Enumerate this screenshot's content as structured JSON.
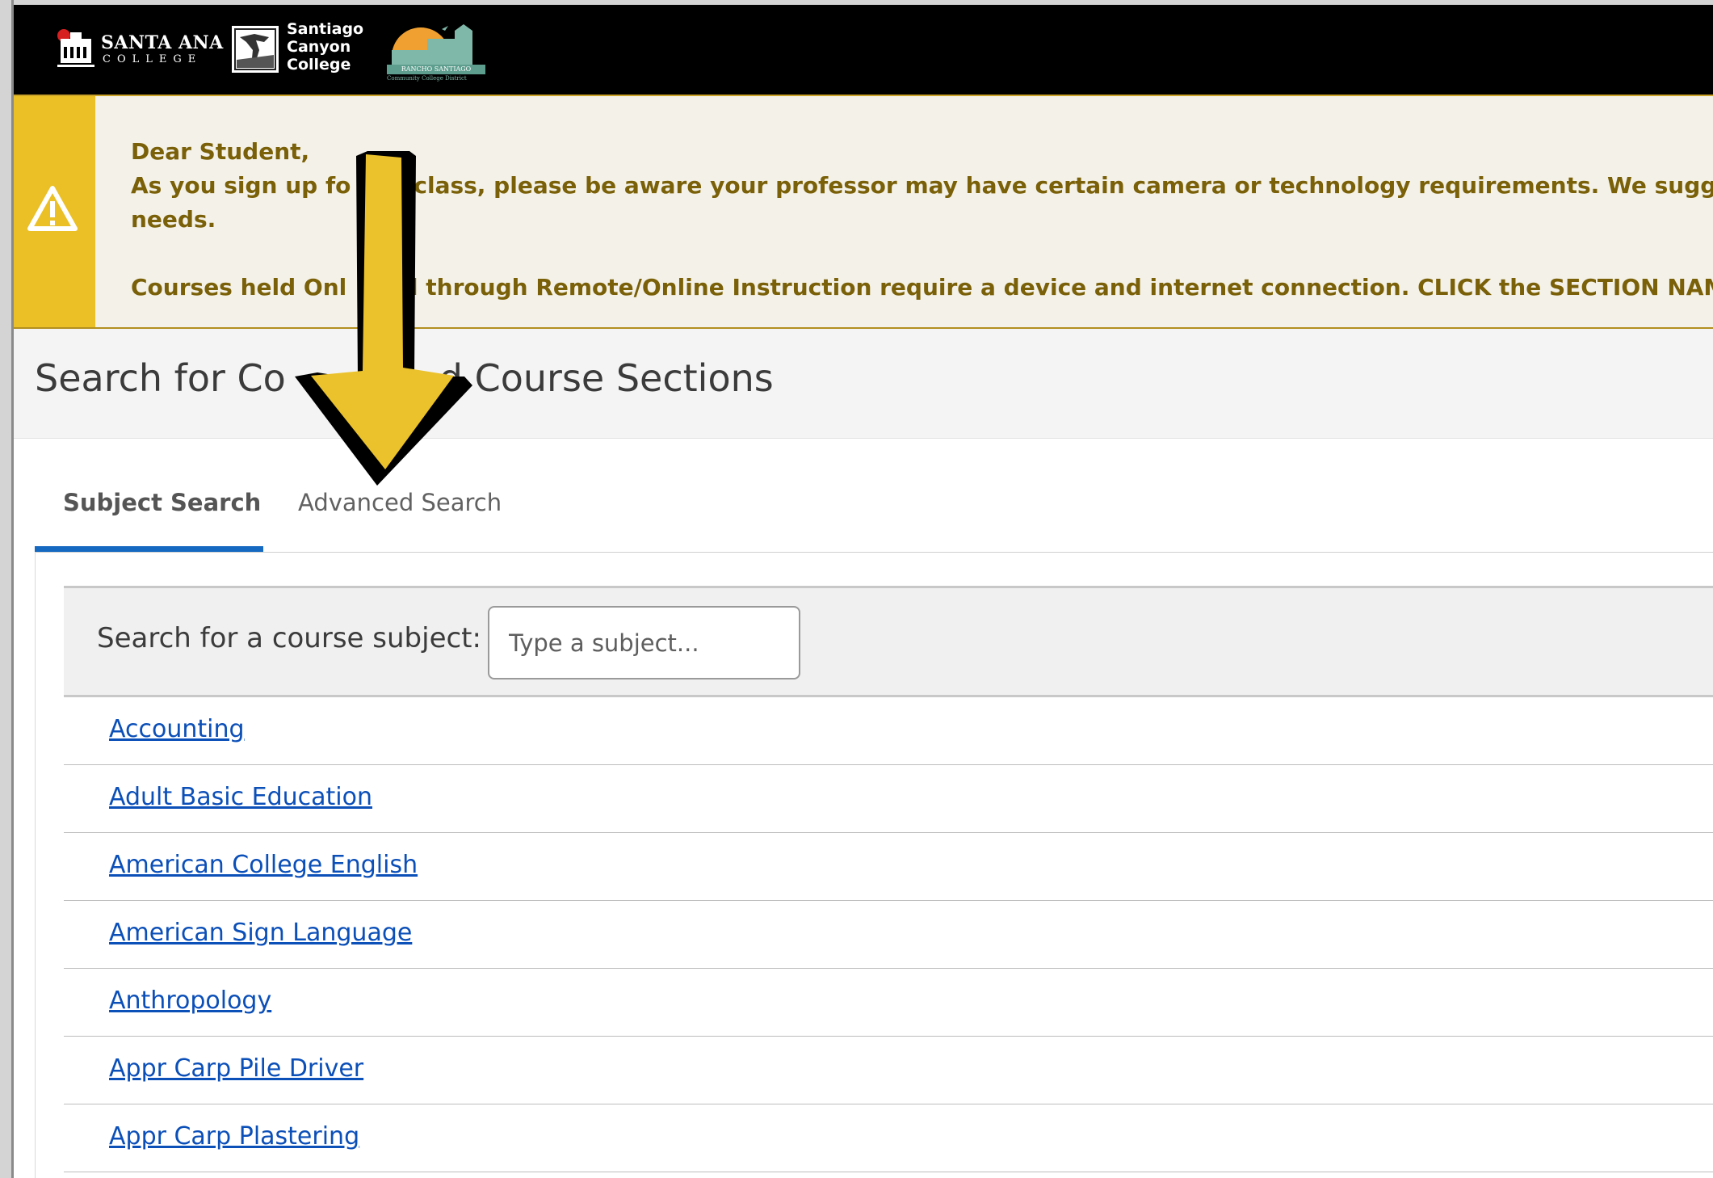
{
  "header": {
    "sac_logo": {
      "name": "SANTA ANA",
      "sub": "COLLEGE"
    },
    "scc_logo": {
      "line1": "Santiago",
      "line2": "Canyon",
      "line3": "College"
    },
    "rsccd_logo": {
      "band": "RANCHO SANTIAGO",
      "sub": "Community College District"
    }
  },
  "alert": {
    "icon": "warning-triangle-icon",
    "line1": "Dear Student,",
    "line2": "As you sign up fo",
    "line2b": "class, please be aware your professor may have certain camera or technology requirements. We suggest you rea",
    "line3": "needs.",
    "line4": "Courses held Onl",
    "line4b": "d through Remote/Online Instruction require a device and internet connection. CLICK the SECTION NAME for imp"
  },
  "page": {
    "title_part1": "Search for Co",
    "title_part2": "d Course Sections"
  },
  "tabs": [
    {
      "label": "Subject Search",
      "active": true
    },
    {
      "label": "Advanced Search",
      "active": false
    }
  ],
  "search": {
    "label": "Search for a course subject:",
    "placeholder": "Type a subject..."
  },
  "subjects": [
    "Accounting",
    "Adult Basic Education",
    "American College English",
    "American Sign Language",
    "Anthropology",
    "Appr Carp Pile Driver",
    "Appr Carp Plastering"
  ],
  "colors": {
    "alert_bar": "#eac026",
    "alert_text": "#7a6008",
    "link": "#0b4fb8",
    "tab_active": "#1669c1",
    "arrow_fill": "#ebc22b"
  }
}
